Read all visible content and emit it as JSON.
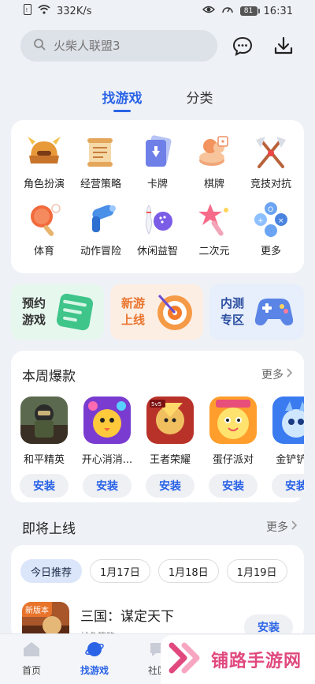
{
  "status_bar": {
    "speed": "332K/s",
    "battery": "81",
    "time": "16:31"
  },
  "search": {
    "placeholder": "火柴人联盟3"
  },
  "tabs": [
    {
      "label": "找游戏",
      "active": true
    },
    {
      "label": "分类",
      "active": false
    }
  ],
  "categories": [
    {
      "label": "角色扮演",
      "icon": "helmet-icon"
    },
    {
      "label": "经营策略",
      "icon": "scroll-icon"
    },
    {
      "label": "卡牌",
      "icon": "cards-icon"
    },
    {
      "label": "棋牌",
      "icon": "poker-chips-icon"
    },
    {
      "label": "竞技对抗",
      "icon": "crossed-axes-icon"
    },
    {
      "label": "体育",
      "icon": "ping-pong-icon"
    },
    {
      "label": "动作冒险",
      "icon": "blaster-icon"
    },
    {
      "label": "休闲益智",
      "icon": "bowling-icon"
    },
    {
      "label": "二次元",
      "icon": "magic-wand-icon"
    },
    {
      "label": "更多",
      "icon": "gamepad-buttons-icon"
    }
  ],
  "promos": [
    {
      "label": "预约游戏",
      "line1": "预约",
      "line2": "游戏",
      "color": "#e6f7ee",
      "text_color": "#333"
    },
    {
      "label": "新游上线",
      "line1": "新游",
      "line2": "上线",
      "color": "#fdeee4",
      "text_color": "#e8742c"
    },
    {
      "label": "内测专区",
      "line1": "内测",
      "line2": "专区",
      "color": "#e7eefc",
      "text_color": "#2a4ea0"
    }
  ],
  "weekly": {
    "title": "本周爆款",
    "more": "更多",
    "games": [
      {
        "name": "和平精英",
        "action": "安装"
      },
      {
        "name": "开心消消...",
        "action": "安装"
      },
      {
        "name": "王者荣耀",
        "action": "安装"
      },
      {
        "name": "蛋仔派对",
        "action": "安装"
      },
      {
        "name": "金铲铲...",
        "action": "安装"
      }
    ]
  },
  "upcoming": {
    "title": "即将上线",
    "more": "更多",
    "date_tabs": [
      "今日推荐",
      "1月17日",
      "1月18日",
      "1月19日"
    ],
    "item": {
      "badge": "新版本",
      "title": "三国：谋定天下",
      "subtitle": "战争策略",
      "action": "安装"
    }
  },
  "bottom_nav": [
    {
      "label": "首页",
      "active": false
    },
    {
      "label": "找游戏",
      "active": true
    },
    {
      "label": "社区",
      "active": false
    },
    {
      "label": "",
      "active": false
    },
    {
      "label": "",
      "active": false
    }
  ],
  "watermark": {
    "text": "铺路手游网"
  },
  "colors": {
    "accent": "#2a63e6",
    "background": "#eef1f6"
  }
}
